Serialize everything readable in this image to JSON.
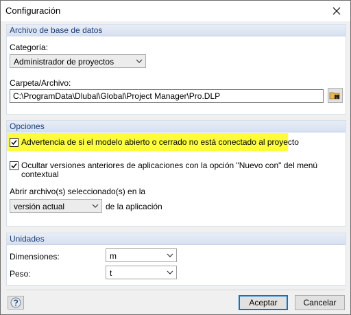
{
  "window": {
    "title": "Configuración"
  },
  "database": {
    "header": "Archivo de base de datos",
    "category_label": "Categoría:",
    "category_value": "Administrador de proyectos",
    "folder_label": "Carpeta/Archivo:",
    "folder_value": "C:\\ProgramData\\Dlubal\\Global\\Project Manager\\Pro.DLP"
  },
  "options": {
    "header": "Opciones",
    "warning_label": "Advertencia de si el modelo abierto o cerrado no está conectado al proyecto",
    "warning_checked": true,
    "hide_label_line1": "Ocultar versiones anteriores de aplicaciones con la opción \"Nuevo con\" del menú",
    "hide_label_line2": "contextual",
    "hide_checked": true,
    "open_with_label": "Abrir archivo(s) seleccionado(s) en la",
    "version_value": "versión actual",
    "app_suffix": "de la aplicación"
  },
  "units": {
    "header": "Unidades",
    "dimensions_label": "Dimensiones:",
    "dimensions_value": "m",
    "weight_label": "Peso:",
    "weight_value": "t"
  },
  "footer": {
    "accept_label": "Aceptar",
    "cancel_label": "Cancelar"
  }
}
